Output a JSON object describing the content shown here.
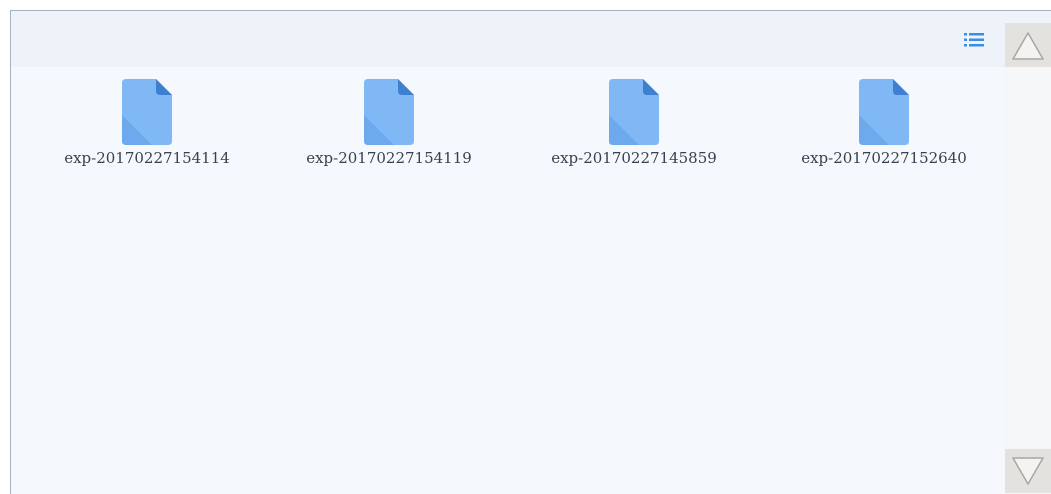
{
  "toolbar": {
    "view_toggle_icon": "list-view-icon",
    "accent_color": "#3a8ee6"
  },
  "files": [
    {
      "name": "exp-20170227154114",
      "icon": "file-icon"
    },
    {
      "name": "exp-20170227154119",
      "icon": "file-icon"
    },
    {
      "name": "exp-20170227145859",
      "icon": "file-icon"
    },
    {
      "name": "exp-20170227152640",
      "icon": "file-icon"
    }
  ],
  "scrollbar": {
    "up_icon": "scroll-up-arrow-icon",
    "down_icon": "scroll-down-arrow-icon"
  },
  "colors": {
    "file_icon": "#7fb8f5",
    "file_icon_fold": "#3f7fcf",
    "background": "#f5f9fd",
    "toolbar": "#eef3fa"
  }
}
